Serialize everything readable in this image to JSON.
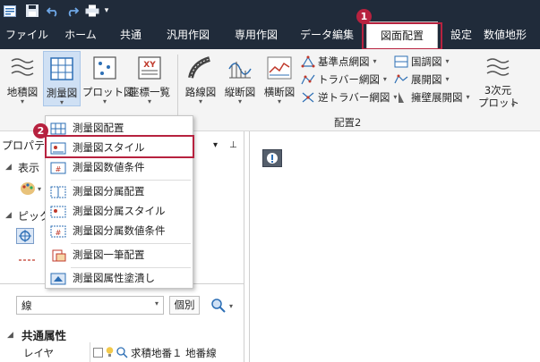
{
  "ribbon_tabs": [
    "ファイル",
    "ホーム",
    "共通",
    "汎用作図",
    "専用作図",
    "データ編集",
    "図面配置",
    "設定",
    "数値地形"
  ],
  "active_tab": "図面配置",
  "ribbon": {
    "buttons": {
      "lot_map": "地積図",
      "survey_map": "測量図",
      "plot_map": "プロット図",
      "coord_list": "座標一覧",
      "route_map": "路線図",
      "profile_map": "縦断図",
      "cross_map": "横断図",
      "plot3d_line1": "3次元",
      "plot3d_line2": "プロット"
    },
    "small_items": {
      "benchmark_net": "基準点網図",
      "traverse_net": "トラバー網図",
      "reverse_traverse_net": "逆トラバー網図",
      "national_survey": "国調図",
      "development": "展開図",
      "retaining_wall": "擁壁展開図"
    },
    "group_label": "配置2",
    "plot_icon_text": "XY"
  },
  "menu": {
    "items": [
      "測量図配置",
      "測量図スタイル",
      "測量図数値条件",
      "測量図分属配置",
      "測量図分属スタイル",
      "測量図分属数値条件",
      "測量図一筆配置",
      "測量図属性塗潰し"
    ],
    "highlighted_index": 1
  },
  "left_panel": {
    "title": "プロパティ",
    "pin_glyph": "⊥",
    "section_display": "表示",
    "section_pick": "ピック",
    "layer_select_value": "線",
    "individual_button": "個別",
    "common_attr_header": "共通属性",
    "layer_label": "レイヤ",
    "layer_value": "求積地番１ 地番線"
  },
  "callouts": {
    "first": "1",
    "second": "2"
  },
  "colors": {
    "titlebar": "#202b3a",
    "highlight": "#b7223f",
    "accent_blue": "#2d6fb5"
  }
}
